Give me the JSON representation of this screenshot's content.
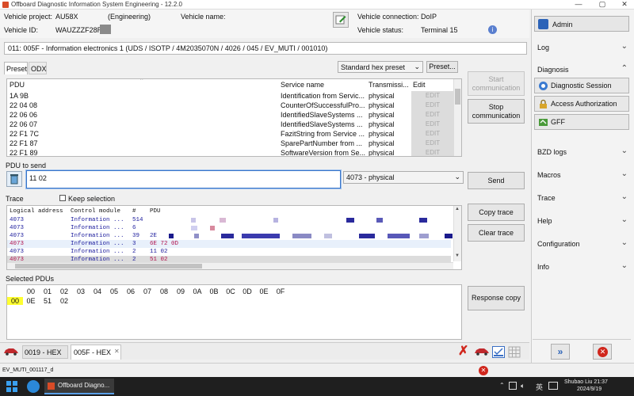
{
  "window": {
    "title": "Offboard Diagnostic Information System Engineering - 12.2.0",
    "min": "—",
    "max": "▢",
    "close": "✕"
  },
  "header": {
    "vehicle_project_label": "Vehicle project:",
    "vehicle_project_value": "AU58X",
    "vehicle_project_type": "(Engineering)",
    "vehicle_name_label": "Vehicle name:",
    "vehicle_id_label": "Vehicle ID:",
    "vehicle_id_value": "WAUZZZF28R",
    "vehicle_connection_label": "Vehicle connection:",
    "vehicle_connection_value": "DoIP",
    "vehicle_status_label": "Vehicle status:",
    "vehicle_status_value": "Terminal 15"
  },
  "ecu_path": "011: 005F - Information electronics 1  (UDS / ISOTP / 4M2035070N / 4026 / 045 / EV_MUTI / 001010)",
  "tabs": {
    "preset": "Preset",
    "odx": "ODX"
  },
  "preset": {
    "selected": "Standard hex preset",
    "button": "Preset..."
  },
  "pdu_table": {
    "columns": [
      "PDU",
      "Service name",
      "Transmissi...",
      "Edit"
    ],
    "rows": [
      {
        "pdu": "1A 9B",
        "service": "Identification from Servic...",
        "trans": "physical",
        "edit": "EDIT"
      },
      {
        "pdu": "22 04 08",
        "service": "CounterOfSuccessfulPro...",
        "trans": "physical",
        "edit": "EDIT"
      },
      {
        "pdu": "22 06 06",
        "service": "IdentifiedSlaveSystems ...",
        "trans": "physical",
        "edit": "EDIT"
      },
      {
        "pdu": "22 06 07",
        "service": "IdentifiedSlaveSystems ...",
        "trans": "physical",
        "edit": "EDIT"
      },
      {
        "pdu": "22 F1 7C",
        "service": "FazitString from Service ...",
        "trans": "physical",
        "edit": "EDIT"
      },
      {
        "pdu": "22 F1 87",
        "service": "SparePartNumber from ...",
        "trans": "physical",
        "edit": "EDIT"
      },
      {
        "pdu": "22 F1 89",
        "service": "SoftwareVersion from Se...",
        "trans": "physical",
        "edit": "EDIT"
      }
    ]
  },
  "buttons": {
    "start_communication": "Start communication",
    "stop_communication": "Stop communication",
    "send": "Send",
    "copy_trace": "Copy trace",
    "clear_trace": "Clear trace",
    "response_copy": "Response copy"
  },
  "pdu_to_send": {
    "label": "PDU to send",
    "value": "11 02",
    "target": "4073 - physical"
  },
  "trace": {
    "label": "Trace",
    "keep_selection": "Keep selection",
    "columns": [
      "Logical address",
      "Control module",
      "#",
      "PDU"
    ],
    "rows": [
      {
        "addr": "4073",
        "module": "Information ...",
        "n": "514",
        "pdu": "",
        "color": "#1a1a9c"
      },
      {
        "addr": "4073",
        "module": "Information ...",
        "n": "6",
        "pdu": "",
        "color": "#1a1a9c"
      },
      {
        "addr": "4073",
        "module": "Information ...",
        "n": "39",
        "pdu": "2E",
        "color": "#1a1a9c"
      },
      {
        "addr": "4073",
        "module": "Information ...",
        "n": "3",
        "pdu": "6E 72 0D",
        "color": "#b0104c"
      },
      {
        "addr": "4073",
        "module": "Information ...",
        "n": "2",
        "pdu": "11 02",
        "color": "#1a1a9c"
      },
      {
        "addr": "4073",
        "module": "Information ...",
        "n": "2",
        "pdu": "51 02",
        "color": "#b0104c"
      }
    ]
  },
  "selected_pdus": {
    "label": "Selected PDUs",
    "header": [
      "00",
      "01",
      "02",
      "03",
      "04",
      "05",
      "06",
      "07",
      "08",
      "09",
      "0A",
      "0B",
      "0C",
      "0D",
      "0E",
      "0F"
    ],
    "row_offset": "00",
    "row_values": [
      "0E",
      "51",
      "02"
    ]
  },
  "bottom_tabs": [
    {
      "label": "0019 - HEX"
    },
    {
      "label": "005F - HEX"
    }
  ],
  "sidebar": {
    "admin": "Admin",
    "log": "Log",
    "diagnosis": "Diagnosis",
    "diagnostic_session": "Diagnostic Session",
    "access_authorization": "Access Authorization",
    "gff": "GFF",
    "bzd_logs": "BZD logs",
    "macros": "Macros",
    "trace": "Trace",
    "help": "Help",
    "configuration": "Configuration",
    "info": "Info"
  },
  "statusbar": {
    "text": "EV_MUTI_001117_d"
  },
  "taskbar": {
    "app": "Offboard Diagno...",
    "lang": "英",
    "user": "Shubao Liu 21:37",
    "date": "2024/9/19"
  }
}
